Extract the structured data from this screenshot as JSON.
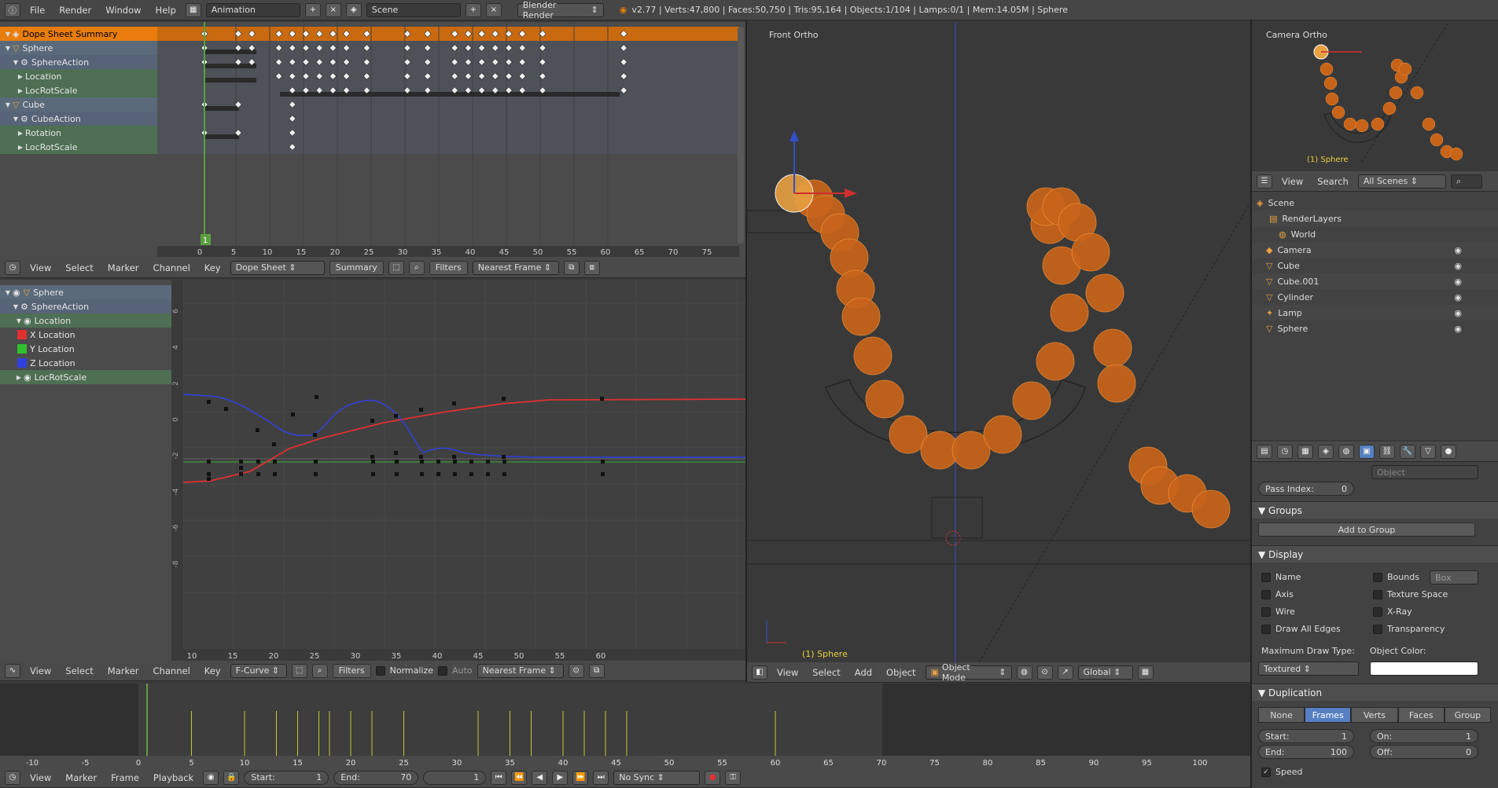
{
  "topbar": {
    "menus": [
      "File",
      "Render",
      "Window",
      "Help"
    ],
    "layout": "Animation",
    "scene": "Scene",
    "engine": "Blender Render",
    "stats": "v2.77 | Verts:47,800 | Faces:50,750 | Tris:95,164 | Objects:1/104 | Lamps:0/1 | Mem:14.05M | Sphere"
  },
  "dopesheet": {
    "channels": [
      {
        "label": "Dope Sheet Summary",
        "kind": "summary"
      },
      {
        "label": "Sphere",
        "kind": "object"
      },
      {
        "label": "SphereAction",
        "kind": "action"
      },
      {
        "label": "Location",
        "kind": "group"
      },
      {
        "label": "LocRotScale",
        "kind": "group"
      },
      {
        "label": "Cube",
        "kind": "object"
      },
      {
        "label": "CubeAction",
        "kind": "action"
      },
      {
        "label": "Rotation",
        "kind": "group"
      },
      {
        "label": "LocRotScale",
        "kind": "group"
      }
    ],
    "current_frame": "1",
    "ruler": [
      "0",
      "5",
      "10",
      "15",
      "20",
      "25",
      "30",
      "35",
      "40",
      "45",
      "50",
      "55",
      "60",
      "65",
      "70",
      "75"
    ],
    "header": {
      "menus": [
        "View",
        "Select",
        "Marker",
        "Channel",
        "Key"
      ],
      "mode": "Dope Sheet",
      "summary": "Summary",
      "filters": "Filters",
      "snap": "Nearest Frame"
    }
  },
  "graph": {
    "channels": [
      {
        "label": "Sphere",
        "color": ""
      },
      {
        "label": "SphereAction",
        "color": ""
      },
      {
        "label": "Location",
        "color": ""
      },
      {
        "label": "X Location",
        "color": "#e03030"
      },
      {
        "label": "Y Location",
        "color": "#30c030"
      },
      {
        "label": "Z Location",
        "color": "#3040e0"
      },
      {
        "label": "LocRotScale",
        "color": ""
      }
    ],
    "yticks": [
      "6",
      "4",
      "2",
      "0",
      "-2",
      "-4",
      "-6",
      "-8"
    ],
    "xticks": [
      "10",
      "15",
      "20",
      "25",
      "30",
      "35",
      "40",
      "45",
      "50",
      "55",
      "60"
    ],
    "header": {
      "menus": [
        "View",
        "Select",
        "Marker",
        "Channel",
        "Key"
      ],
      "mode": "F-Curve",
      "filters": "Filters",
      "normalize": "Normalize",
      "auto": "Auto",
      "snap": "Nearest Frame"
    }
  },
  "viewport": {
    "label": "Front Ortho",
    "object_label": "(1) Sphere",
    "header": {
      "menus": [
        "View",
        "Select",
        "Add",
        "Object"
      ],
      "mode": "Object Mode",
      "orientation": "Global"
    }
  },
  "camera_view": {
    "label": "Camera Ortho",
    "object_label": "(1) Sphere"
  },
  "outliner": {
    "menus": [
      "View",
      "Search"
    ],
    "filter": "All Scenes",
    "items": [
      "Scene",
      "RenderLayers",
      "World",
      "Camera",
      "Cube",
      "Cube.001",
      "Cylinder",
      "Lamp",
      "Sphere"
    ]
  },
  "properties": {
    "object_field": "Object",
    "pass_index_label": "Pass Index:",
    "pass_index_value": "0",
    "groups_title": "Groups",
    "add_to_group": "Add to Group",
    "display_title": "Display",
    "display_left": [
      "Name",
      "Axis",
      "Wire",
      "Draw All Edges"
    ],
    "display_right": [
      "Bounds",
      "Texture Space",
      "X-Ray",
      "Transparency"
    ],
    "bounds_type": "Box",
    "max_draw_type_label": "Maximum Draw Type:",
    "max_draw_type": "Textured",
    "object_color_label": "Object Color:",
    "duplication_title": "Duplication",
    "dup_tabs": [
      "None",
      "Frames",
      "Verts",
      "Faces",
      "Group"
    ],
    "dup_active": "Frames",
    "start_label": "Start:",
    "start_value": "1",
    "end_label": "End:",
    "end_value": "100",
    "on_label": "On:",
    "on_value": "1",
    "off_label": "Off:",
    "off_value": "0",
    "speed_label": "Speed"
  },
  "timeline": {
    "ruler": [
      "-10",
      "-5",
      "0",
      "5",
      "10",
      "15",
      "20",
      "25",
      "30",
      "35",
      "40",
      "45",
      "50",
      "55",
      "60",
      "65",
      "70",
      "75",
      "80",
      "85",
      "90",
      "95",
      "100"
    ],
    "menus": [
      "View",
      "Marker",
      "Frame",
      "Playback"
    ],
    "start_label": "Start:",
    "start_value": "1",
    "end_label": "End:",
    "end_value": "70",
    "current": "1",
    "sync": "No Sync"
  },
  "colors": {
    "accent": "#e87d0d",
    "selected": "#5680c2",
    "x": "#e03030",
    "y": "#30c030",
    "z": "#3040e0"
  }
}
